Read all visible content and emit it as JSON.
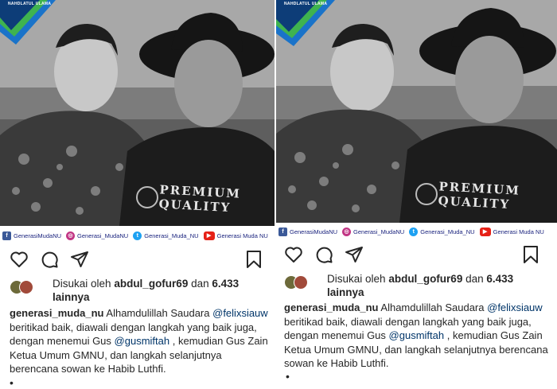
{
  "posts": [
    {
      "badge_text": "NAHDLATUL ULAMA",
      "shirt_text_line1": "PREMIUM",
      "shirt_text_line2": "QUALITY",
      "social": [
        {
          "icon": "facebook-icon",
          "label": "GenerasiMudaNU"
        },
        {
          "icon": "instagram-icon",
          "label": "Generasi_MudaNU"
        },
        {
          "icon": "twitter-icon",
          "label": "Generasi_Muda_NU"
        },
        {
          "icon": "youtube-icon",
          "label": "Generasi Muda NU"
        }
      ],
      "likes_prefix": "Disukai oleh",
      "likes_user": "abdul_gofur69",
      "likes_and": "dan",
      "likes_count": "6.433",
      "likes_suffix": "lainnya",
      "caption_user": "generasi_muda_nu",
      "caption_part1": "Alhamdulillah Saudara",
      "mention1": "@felixsiauw",
      "caption_part2": "beritikad baik, diawali dengan langkah yang baik juga, dengan menemui Gus",
      "mention2": "@gusmiftah",
      "caption_part3": ", kemudian Gus Zain Ketua Umum GMNU, dan langkah selanjutnya berencana sowan ke Habib Luthfi.",
      "more_dot": "•"
    },
    {
      "badge_text": "NAHDLATUL ULAMA",
      "shirt_text_line1": "PREMIUM",
      "shirt_text_line2": "QUALITY",
      "social": [
        {
          "icon": "facebook-icon",
          "label": "GenerasiMudaNU"
        },
        {
          "icon": "instagram-icon",
          "label": "Generasi_MudaNU"
        },
        {
          "icon": "twitter-icon",
          "label": "Generasi_Muda_NU"
        },
        {
          "icon": "youtube-icon",
          "label": "Generasi Muda NU"
        }
      ],
      "likes_prefix": "Disukai oleh",
      "likes_user": "abdul_gofur69",
      "likes_and": "dan",
      "likes_count": "6.433",
      "likes_suffix": "lainnya",
      "caption_user": "generasi_muda_nu",
      "caption_part1": "Alhamdulillah Saudara",
      "mention1": "@felixsiauw",
      "caption_part2": "beritikad baik, diawali dengan langkah yang baik juga, dengan menemui Gus",
      "mention2": "@gusmiftah",
      "caption_part3": ", kemudian Gus Zain Ketua Umum GMNU, dan langkah selanjutnya berencana sowan ke Habib Luthfi.",
      "more_dot": "•"
    }
  ],
  "colors": {
    "badge_green": "#3fb34f",
    "badge_blue": "#1a73c9",
    "mention": "#003569",
    "social_text": "#1a237e"
  }
}
